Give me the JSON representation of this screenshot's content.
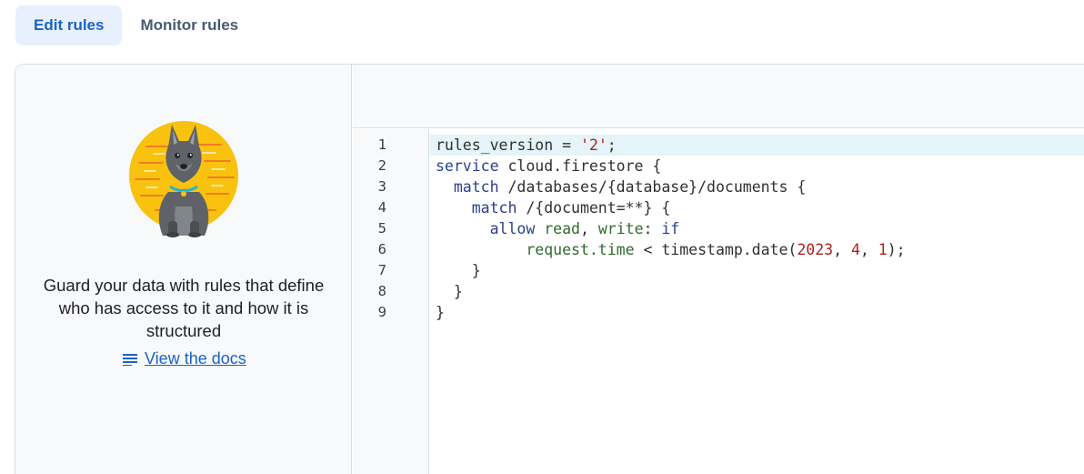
{
  "tabs": [
    {
      "label": "Edit rules",
      "active": true
    },
    {
      "label": "Monitor rules",
      "active": false
    }
  ],
  "left_panel": {
    "description": "Guard your data with rules that define who has access to it and how it is structured",
    "docs_link": "View the docs",
    "mascot": "dog-mascot-icon"
  },
  "editor": {
    "line_numbers": [
      "1",
      "2",
      "3",
      "4",
      "5",
      "6",
      "7",
      "8",
      "9"
    ],
    "lines": {
      "l1": {
        "a": "rules_version = ",
        "b": "'2'",
        "c": ";"
      },
      "l2": {
        "a": "service",
        "b": " cloud.firestore {"
      },
      "l3": {
        "a": "  match",
        "b": " /databases/{database}/documents {"
      },
      "l4": {
        "a": "    match",
        "b": " /{document=**} {"
      },
      "l5": {
        "a": "      allow",
        "b": " read",
        "c": ", ",
        "d": "write",
        "e": ": ",
        "f": "if"
      },
      "l6": {
        "a": "          request.time",
        "b": " < timestamp.date(",
        "c": "2023",
        "d": ", ",
        "e": "4",
        "f": ", ",
        "g": "1",
        "h": ");"
      },
      "l7": {
        "a": "    }"
      },
      "l8": {
        "a": "  }"
      },
      "l9": {
        "a": "}"
      }
    }
  },
  "colors": {
    "accent": "#1a62c7",
    "active_tab_bg": "#e8f0fe",
    "current_line": "#e4f4f8",
    "mascot_sun": "#f9c20f"
  }
}
